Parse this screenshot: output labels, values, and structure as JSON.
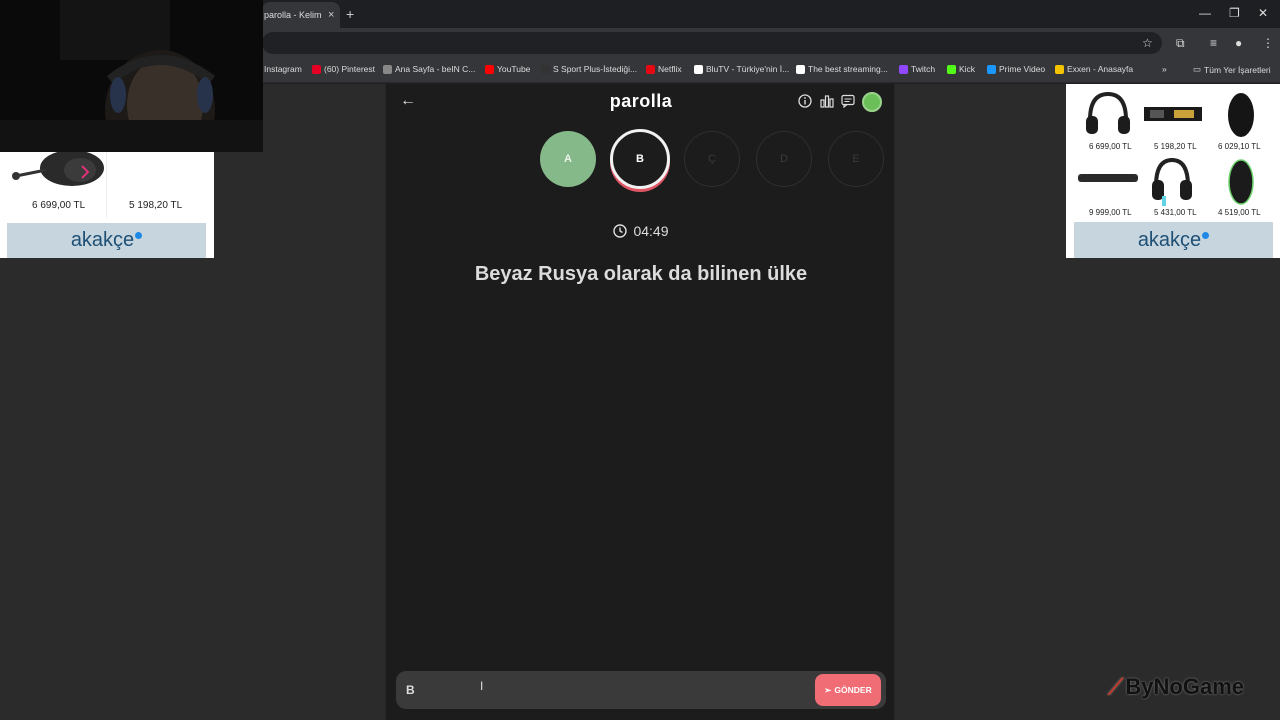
{
  "browser": {
    "tab_title": "parolla - Kelime",
    "tab_close": "×",
    "new_tab": "+",
    "bookmarks": [
      {
        "label": "Instagram",
        "color": "#d6249f"
      },
      {
        "label": "(60) Pinterest",
        "color": "#e60023"
      },
      {
        "label": "Ana Sayfa - beIN C...",
        "color": "#888888"
      },
      {
        "label": "YouTube",
        "color": "#ff0000"
      },
      {
        "label": "S Sport Plus-İstediği...",
        "color": "#333333"
      },
      {
        "label": "Netflix",
        "color": "#e50914"
      },
      {
        "label": "BluTV - Türkiye'nin İ...",
        "color": "#ffffff"
      },
      {
        "label": "The best streaming...",
        "color": "#ffffff"
      },
      {
        "label": "Twitch",
        "color": "#9146ff"
      },
      {
        "label": "Kick",
        "color": "#53fc18"
      },
      {
        "label": "Prime Video",
        "color": "#1a98ff"
      },
      {
        "label": "Exxen - Anasayfa",
        "color": "#f5c400"
      }
    ],
    "bookmarks_more": "»",
    "all_bookmarks": "Tüm Yer İşaretleri"
  },
  "app": {
    "logo": "parolla",
    "back": "←",
    "letters": [
      {
        "char": "A",
        "state": "done"
      },
      {
        "char": "B",
        "state": "active"
      },
      {
        "char": "Ç",
        "state": "pending"
      },
      {
        "char": "D",
        "state": "pending"
      },
      {
        "char": "E",
        "state": "pending"
      }
    ],
    "timer": "04:49",
    "question": "Beyaz Rusya olarak da bilinen ülke",
    "answer_value": "B",
    "send_label": "GÖNDER",
    "accent": "#f06d75",
    "done_color": "#86b98a"
  },
  "ads": {
    "brand": "akakçe",
    "left_prices": [
      "6 699,00 TL",
      "5 198,20 TL"
    ],
    "right_prices": [
      "6 699,00 TL",
      "5 198,20 TL",
      "6 029,10 TL",
      "9 999,00 TL",
      "5 431,00 TL",
      "4 519,00 TL"
    ]
  },
  "watermark": "ByNoGame"
}
